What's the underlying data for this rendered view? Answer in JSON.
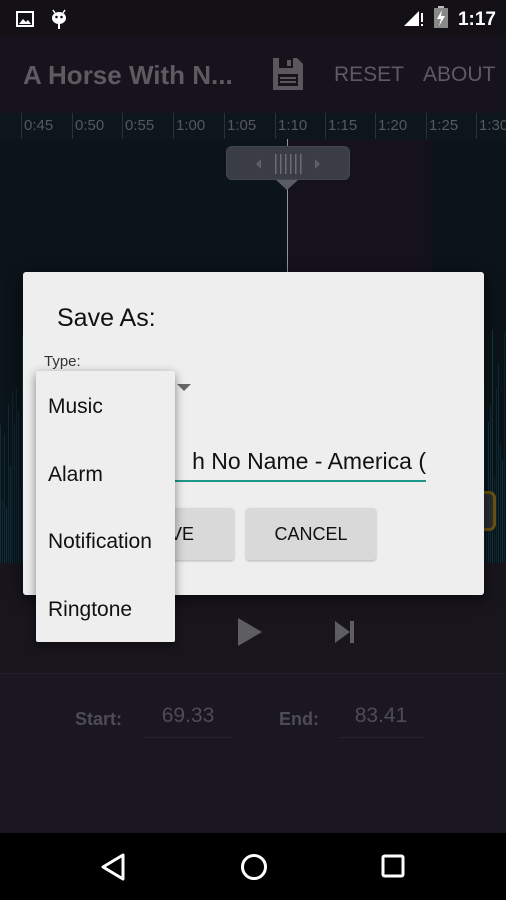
{
  "status_bar": {
    "left_icons": [
      "image-notification-icon",
      "android-debug-icon"
    ],
    "right_icons": [
      "signal-no-data-icon",
      "battery-charging-icon"
    ],
    "time": "1:17"
  },
  "app_bar": {
    "title": "A Horse With N...",
    "save_icon": "floppy-disk-icon",
    "reset_label": "RESET",
    "about_label": "ABOUT"
  },
  "timeline": {
    "ticks": [
      "0:45",
      "0:50",
      "0:55",
      "1:00",
      "1:05",
      "1:10",
      "1:15",
      "1:20",
      "1:25",
      "1:30"
    ]
  },
  "player": {
    "play_icon": "play-icon",
    "next_icon": "skip-next-icon",
    "start_label": "Start:",
    "start_value": "69.33",
    "end_label": "End:",
    "end_value": "83.41"
  },
  "dialog": {
    "title": "Save As:",
    "type_label": "Type:",
    "name_value": "h No Name - America (",
    "save_label": "VE",
    "cancel_label": "CANCEL"
  },
  "dropdown": {
    "options": [
      "Music",
      "Alarm",
      "Notification",
      "Ringtone"
    ]
  },
  "nav_bar": {
    "back_icon": "back-icon",
    "home_icon": "home-icon",
    "recents_icon": "recents-icon"
  },
  "colors": {
    "accent": "#1e9688",
    "background": "#1b1722",
    "dialog_bg": "#eeeeee",
    "waveform": "#1f5f78"
  }
}
